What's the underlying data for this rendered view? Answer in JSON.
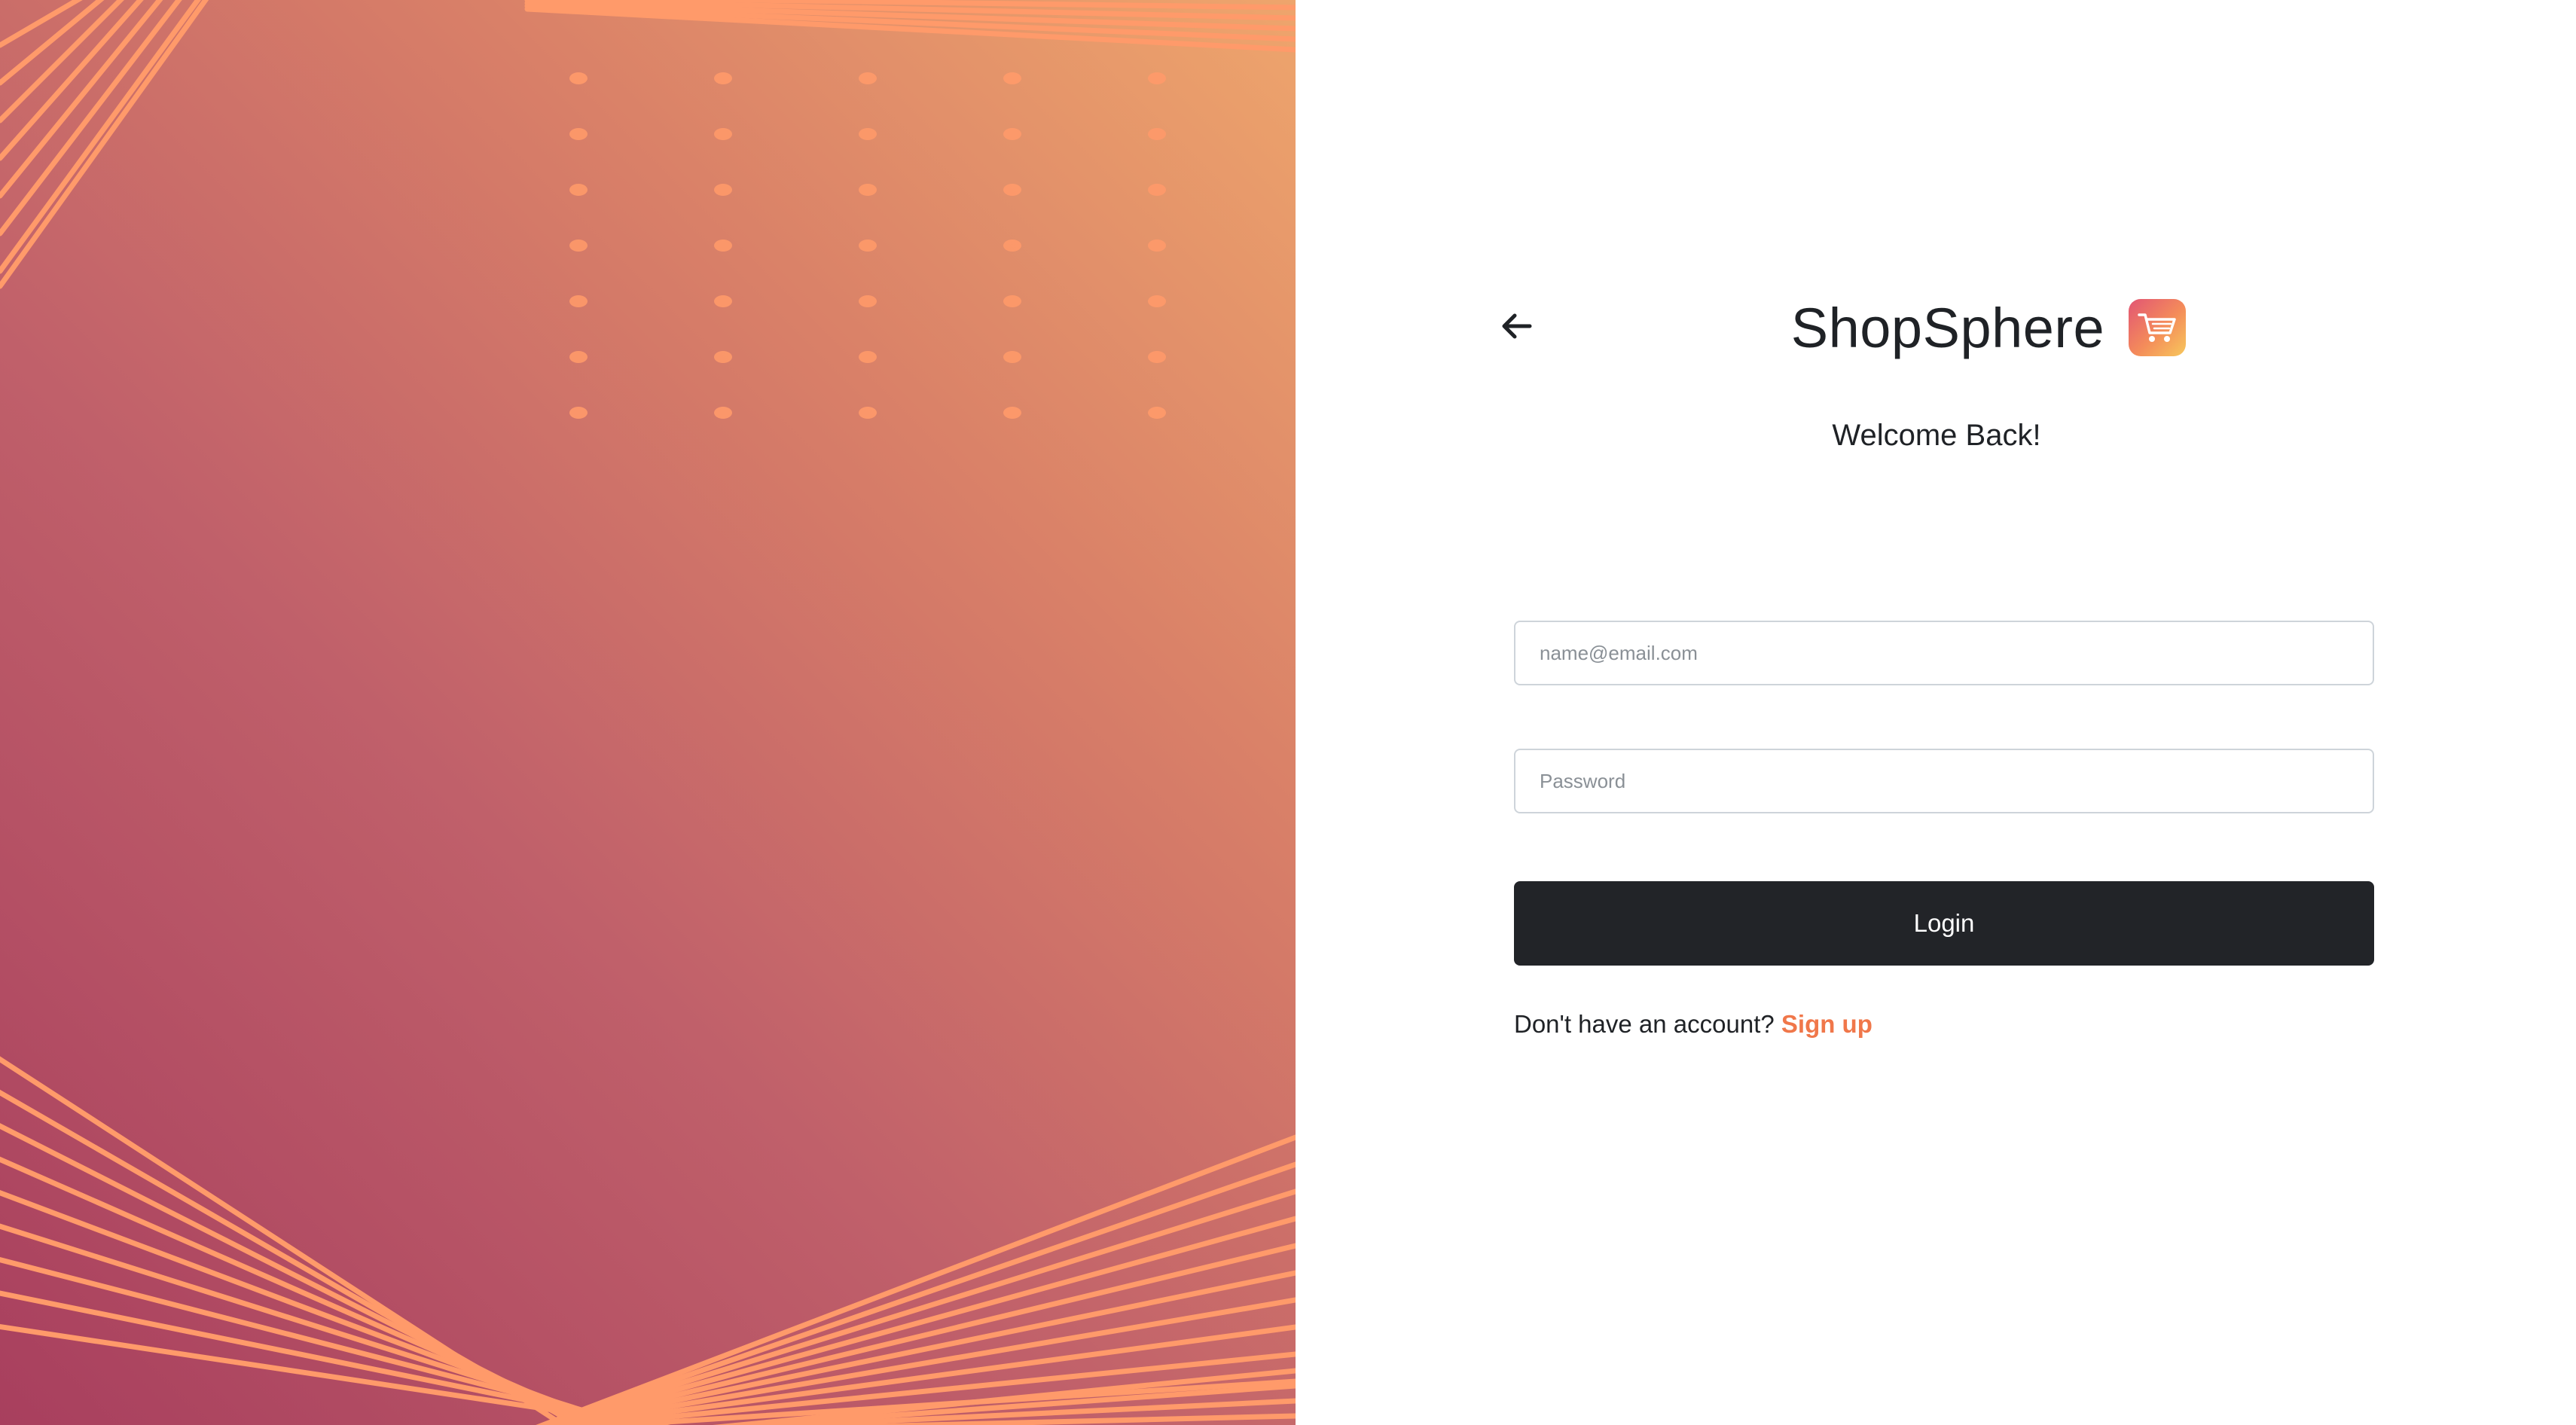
{
  "app": {
    "brand_name": "ShopSphere",
    "logo_icon": "shopping-cart-icon"
  },
  "login": {
    "welcome_text": "Welcome Back!",
    "email_placeholder": "name@email.com",
    "email_value": "",
    "password_placeholder": "Password",
    "password_value": "",
    "login_label": "Login",
    "signup_prompt": "Don't have an account?",
    "signup_link": "Sign up",
    "back_icon": "arrow-left-icon"
  },
  "colors": {
    "accent": "#f0774a",
    "button_bg": "#222428",
    "hero_gradient_start": "#a83f5e",
    "hero_gradient_end": "#eea56c",
    "hero_line": "#ff9a6a"
  }
}
